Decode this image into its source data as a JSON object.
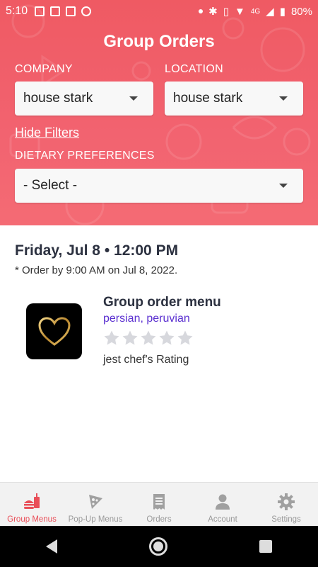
{
  "status_bar": {
    "time": "5:10",
    "network": "4G",
    "battery": "80%"
  },
  "header": {
    "title": "Group Orders",
    "company": {
      "label": "COMPANY",
      "value": "house stark"
    },
    "location": {
      "label": "LOCATION",
      "value": "house stark"
    },
    "hide_filters": "Hide Filters",
    "dietary": {
      "label": "DIETARY PREFERENCES",
      "value": "- Select -"
    }
  },
  "schedule": {
    "day": "Friday, Jul 8",
    "separator": " • ",
    "time": "12:00 PM",
    "order_by": "* Order by 9:00 AM on Jul 8, 2022."
  },
  "menu": {
    "title": "Group order menu",
    "cuisine": "persian, peruvian",
    "rating_stars": 0,
    "rating_max": 5,
    "rating_label": "jest chef's Rating"
  },
  "bottom_nav": {
    "items": [
      {
        "label": "Group Menus",
        "icon": "burger-drink-icon",
        "active": true
      },
      {
        "label": "Pop-Up Menus",
        "icon": "pizza-icon",
        "active": false
      },
      {
        "label": "Orders",
        "icon": "receipt-icon",
        "active": false
      },
      {
        "label": "Account",
        "icon": "person-icon",
        "active": false
      },
      {
        "label": "Settings",
        "icon": "gear-icon",
        "active": false
      }
    ]
  },
  "colors": {
    "accent": "#ef5a63",
    "cuisine_link": "#5a2fd0",
    "star_empty": "#d7d8dd"
  }
}
